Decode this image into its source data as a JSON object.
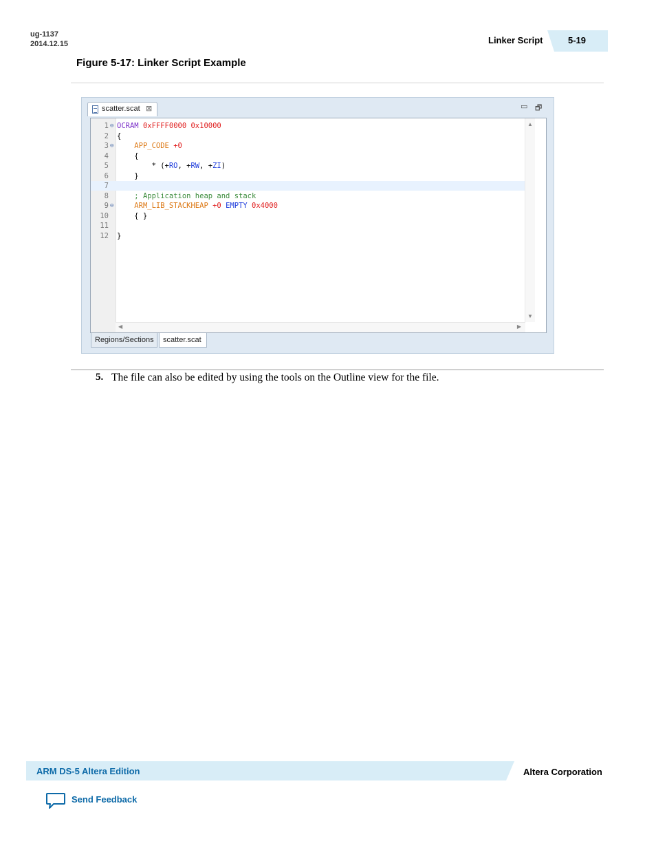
{
  "header": {
    "doc_id": "ug-1137",
    "date": "2014.12.15",
    "section_title": "Linker Script",
    "page_number": "5-19"
  },
  "figure": {
    "caption": "Figure 5-17: Linker Script Example",
    "ide": {
      "tab_label": "scatter.scat",
      "bottom_tabs": [
        "Regions/Sections",
        "scatter.scat"
      ],
      "code": [
        {
          "n": "1",
          "fold": true,
          "parts": [
            [
              "c-purple",
              "OCRAM"
            ],
            [
              "c-black",
              " "
            ],
            [
              "c-red",
              "0xFFFF0000 0x10000"
            ]
          ]
        },
        {
          "n": "2",
          "fold": false,
          "parts": [
            [
              "c-black",
              "{"
            ]
          ]
        },
        {
          "n": "3",
          "fold": true,
          "parts": [
            [
              "c-black",
              "    "
            ],
            [
              "c-orange",
              "APP_CODE"
            ],
            [
              "c-black",
              " "
            ],
            [
              "c-red",
              "+0"
            ]
          ]
        },
        {
          "n": "4",
          "fold": false,
          "parts": [
            [
              "c-black",
              "    {"
            ]
          ]
        },
        {
          "n": "5",
          "fold": false,
          "parts": [
            [
              "c-black",
              "        * (+"
            ],
            [
              "c-blue",
              "RO"
            ],
            [
              "c-black",
              ", +"
            ],
            [
              "c-blue",
              "RW"
            ],
            [
              "c-black",
              ", +"
            ],
            [
              "c-blue",
              "ZI"
            ],
            [
              "c-black",
              ")"
            ]
          ]
        },
        {
          "n": "6",
          "fold": false,
          "parts": [
            [
              "c-black",
              "    }"
            ]
          ]
        },
        {
          "n": "7",
          "fold": false,
          "parts": [],
          "current": true
        },
        {
          "n": "8",
          "fold": false,
          "parts": [
            [
              "c-black",
              "    "
            ],
            [
              "c-green",
              "; Application heap and stack"
            ]
          ]
        },
        {
          "n": "9",
          "fold": true,
          "parts": [
            [
              "c-black",
              "    "
            ],
            [
              "c-orange",
              "ARM_LIB_STACKHEAP"
            ],
            [
              "c-black",
              " "
            ],
            [
              "c-red",
              "+0"
            ],
            [
              "c-black",
              " "
            ],
            [
              "c-blue",
              "EMPTY"
            ],
            [
              "c-black",
              " "
            ],
            [
              "c-red",
              "0x4000"
            ]
          ]
        },
        {
          "n": "10",
          "fold": false,
          "parts": [
            [
              "c-black",
              "    { }"
            ]
          ]
        },
        {
          "n": "11",
          "fold": false,
          "parts": []
        },
        {
          "n": "12",
          "fold": false,
          "parts": [
            [
              "c-black",
              "}"
            ]
          ]
        }
      ]
    }
  },
  "step": {
    "number": "5.",
    "text": "The file can also be edited by using the tools on the Outline view for the file."
  },
  "footer": {
    "product": "ARM DS-5 Altera Edition",
    "company": "Altera Corporation",
    "feedback": "Send Feedback"
  },
  "colors": {
    "accent_blue": "#0d6aa8",
    "band": "#d8edf7"
  }
}
